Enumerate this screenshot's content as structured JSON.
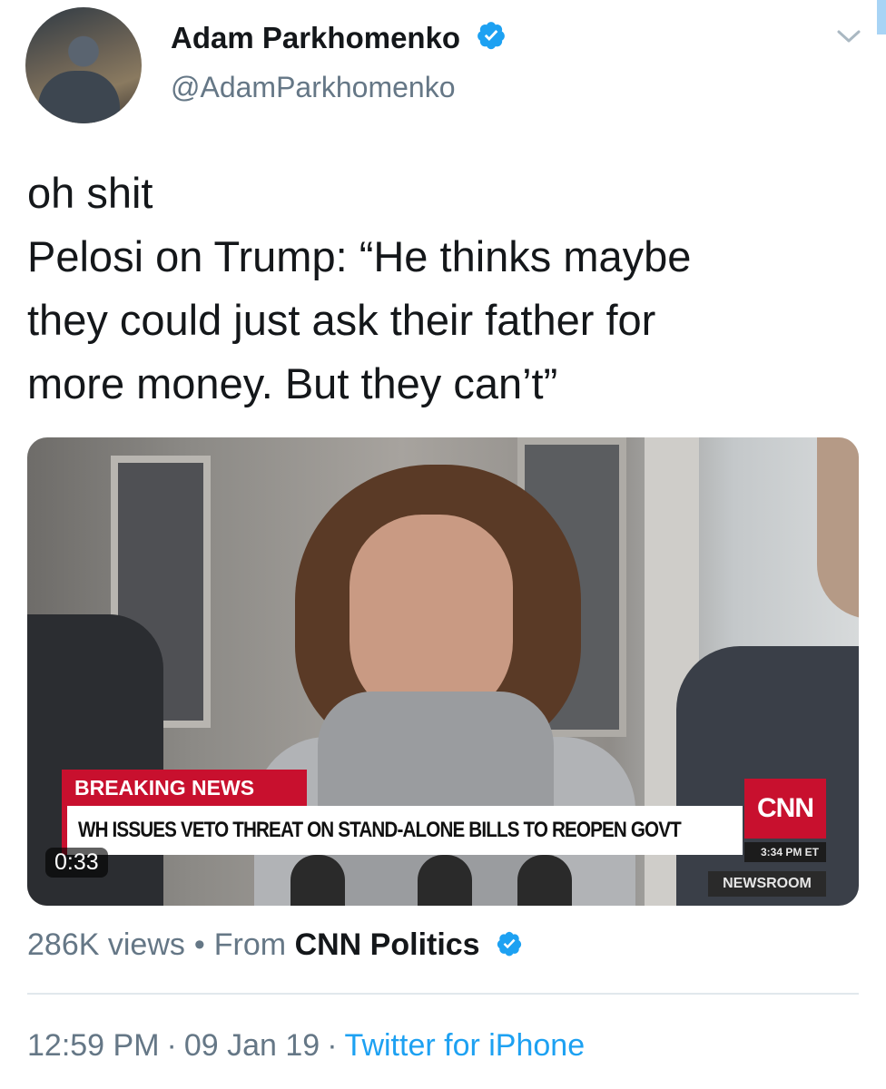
{
  "author": {
    "name": "Adam Parkhomenko",
    "handle": "@AdamParkhomenko",
    "verified_color": "#1da1f2"
  },
  "tweet": {
    "lines": [
      "oh shit",
      "Pelosi on Trump: “He thinks maybe",
      "they could just ask their father for",
      "more money. But they can’t”"
    ]
  },
  "video": {
    "duration": "0:33",
    "chyron": {
      "tag": "BREAKING NEWS",
      "headline": "WH ISSUES VETO THREAT ON STAND-ALONE BILLS TO REOPEN GOVT",
      "logo": "CNN",
      "time": "3:34 PM ET",
      "program": "NEWSROOM"
    }
  },
  "meta": {
    "views": "286K views",
    "separator": "•",
    "from_label": "From",
    "source": "CNN Politics"
  },
  "footer": {
    "time": "12:59 PM",
    "date": "09 Jan 19",
    "separator": "·",
    "client": "Twitter for iPhone"
  },
  "icons": {
    "menu": "chevron-down-icon",
    "verified": "verified-badge-icon"
  }
}
